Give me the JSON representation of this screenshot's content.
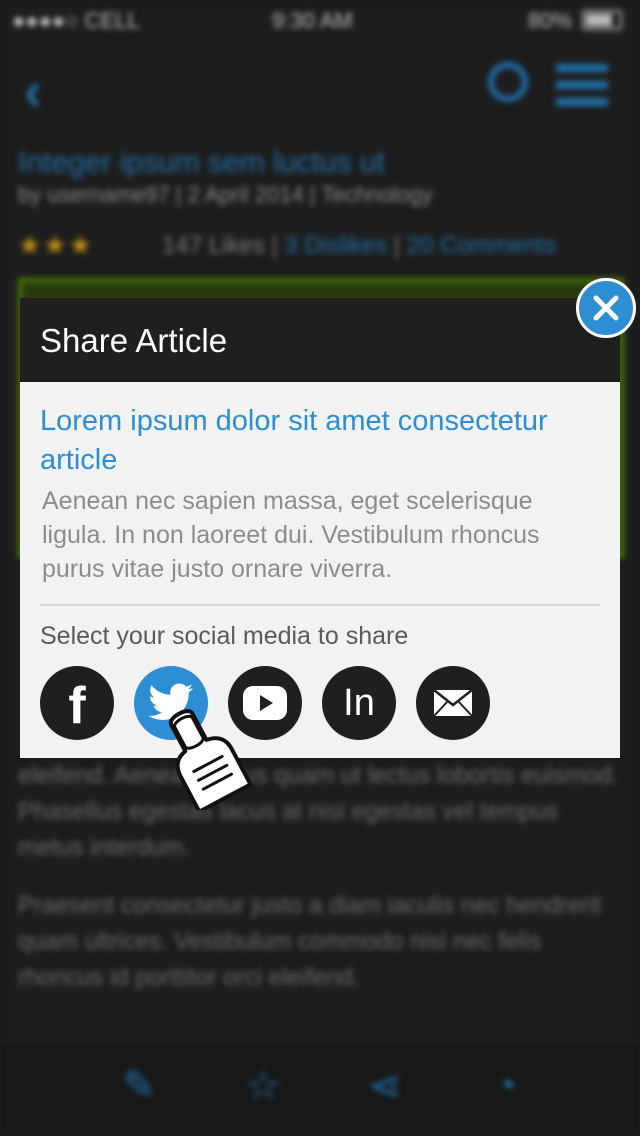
{
  "status_bar": {
    "carrier": "●●●●○ CELL",
    "time": "9:30 AM",
    "battery_pct": "80%"
  },
  "background": {
    "title": "Integer ipsum sem luctus ut",
    "byline": "by username97 | 2 April 2014 | Technology",
    "stars": "★★★",
    "likes": "147 Likes",
    "dislikes": "3 Dislikes",
    "comments": "20 Comments",
    "paragraph_1": "eleifend. Aenean varius quam ut lectus lobortis euismod. Phasellus egestas lacus at nisi egestas vel tempus metus interdum.",
    "paragraph_2": "Praesent consectetur justo a diam iaculis nec hendrerit quam ultrices. Vestibulum commodo nisi nec felis rhoncus id porttitor orci eleifend."
  },
  "share": {
    "title": "Share Article",
    "article_title": "Lorem ipsum dolor sit amet consectetur article",
    "article_summary": "Aenean nec sapien massa, eget scelerisque ligula. In non laoreet dui. Vestibulum rhoncus purus vitae justo ornare viverra.",
    "prompt": "Select your social media to share",
    "services": [
      {
        "name": "Facebook",
        "icon": "facebook-icon",
        "label": "f"
      },
      {
        "name": "Twitter",
        "icon": "twitter-bird-icon",
        "selected": true
      },
      {
        "name": "YouTube",
        "icon": "youtube-play-icon"
      },
      {
        "name": "LinkedIn",
        "icon": "linkedin-icon",
        "label": "In"
      },
      {
        "name": "Email",
        "icon": "envelope-icon"
      }
    ]
  },
  "colors": {
    "accent": "#2d8ed3",
    "header": "#1f1f1f",
    "modal_bg": "#f2f2f2"
  }
}
